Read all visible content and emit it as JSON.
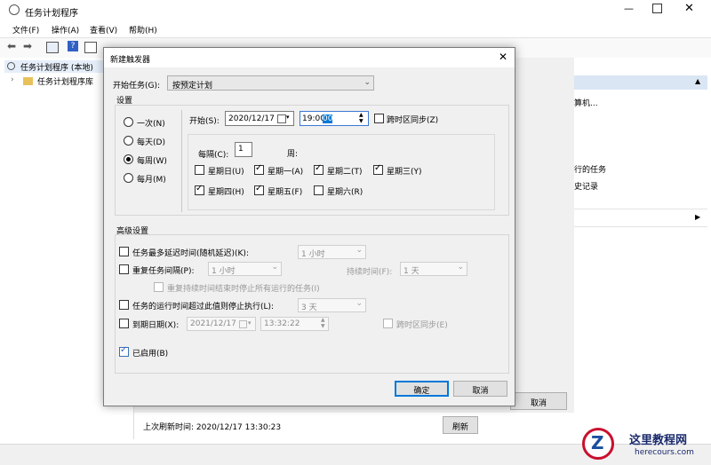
{
  "main_window": {
    "title": "任务计划程序",
    "menu": [
      "文件(F)",
      "操作(A)",
      "查看(V)",
      "帮助(H)"
    ],
    "tree": [
      "任务计划程序 (本地)",
      "任务计划程序库"
    ],
    "right_panel": [
      "算机...",
      "行的任务",
      "史记录"
    ],
    "cancel_label": "取消",
    "last_refresh": "上次刷新时间: 2020/12/17 13:30:23",
    "refresh_label": "刷新"
  },
  "dialog": {
    "title": "新建触发器",
    "begin_task_label": "开始任务(G):",
    "begin_task_value": "按预定计划",
    "settings_label": "设置",
    "freq_options": [
      "一次(N)",
      "每天(D)",
      "每周(W)",
      "每月(M)"
    ],
    "selected_freq": 2,
    "start_label": "开始(S):",
    "start_date": "2020/12/17",
    "start_time_prefix": "19:00:",
    "start_time_sel": "00",
    "sync_tz_label": "跨时区同步(Z)",
    "every_label": "每隔(C):",
    "every_value": "1",
    "week_unit": "周:",
    "weekdays": [
      {
        "label": "星期日(U)",
        "checked": false
      },
      {
        "label": "星期一(A)",
        "checked": true
      },
      {
        "label": "星期二(T)",
        "checked": true
      },
      {
        "label": "星期三(Y)",
        "checked": true
      },
      {
        "label": "星期四(H)",
        "checked": true
      },
      {
        "label": "星期五(F)",
        "checked": true
      },
      {
        "label": "星期六(R)",
        "checked": false
      }
    ],
    "advanced_label": "高级设置",
    "delay_label": "任务最多延迟时间(随机延迟)(K):",
    "delay_value": "1 小时",
    "repeat_label": "重复任务间隔(P):",
    "repeat_value": "1 小时",
    "duration_label": "持续时间(F):",
    "duration_value": "1 天",
    "stop_running_label": "重复持续时间结束时停止所有运行的任务(I)",
    "stop_longer_label": "任务的运行时间超过此值则停止执行(L):",
    "stop_longer_value": "3 天",
    "expire_label": "到期日期(X):",
    "expire_date": "2021/12/17",
    "expire_time": "13:32:22",
    "expire_sync_label": "跨时区同步(E)",
    "enabled_label": "已启用(B)",
    "ok_label": "确定",
    "cancel_label": "取消"
  },
  "watermark": {
    "site": "这里教程网",
    "url": "herecours.com"
  }
}
